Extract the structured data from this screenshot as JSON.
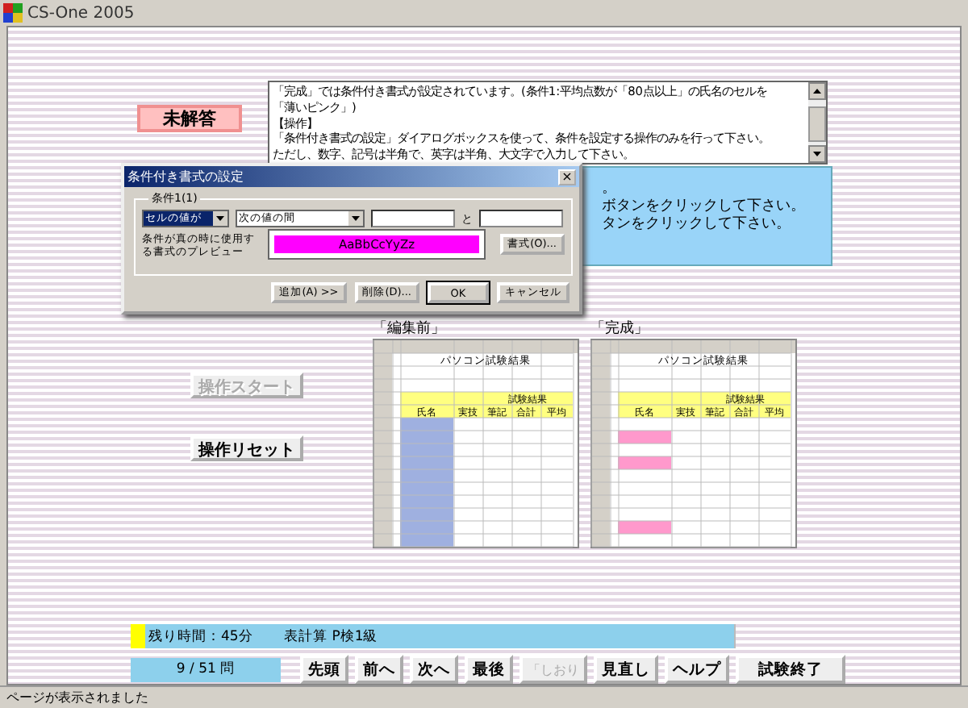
{
  "window": {
    "title": "CS-One 2005"
  },
  "answer_badge": "未解答",
  "instructions": [
    "「完成」では条件付き書式が設定されています。(条件1:平均点数が「80点以上」の氏名のセルを",
    "「薄いピンク」)",
    "【操作】",
    "「条件付き書式の設定」ダイアログボックスを使って、条件を設定する操作のみを行って下さい。",
    "ただし、数字、記号は半角で、英字は半角、大文字で入力して下さい。"
  ],
  "hint_panel": [
    "。",
    "ボタンをクリックして下さい。",
    "タンをクリックして下さい。"
  ],
  "dialog": {
    "title": "条件付き書式の設定",
    "close": "×",
    "group": "条件1(1)",
    "condition_type": "セルの値が",
    "operator": "次の値の間",
    "and_label": "と",
    "preview_label": "条件が真の時に使用する書式のプレビュー",
    "preview_text": "AaBbCcYyZz",
    "format_button": "書式(O)...",
    "buttons": [
      "追加(A) >>",
      "削除(D)...",
      "OK",
      "キャンセル"
    ]
  },
  "sheets": [
    {
      "caption": "「編集前」",
      "title": "パソコン試験結果",
      "group_header": "試験結果",
      "columns": [
        "氏名",
        "実技",
        "筆記",
        "合計",
        "平均"
      ],
      "name_selection": true,
      "rows": [
        {
          "highlighted": false
        },
        {
          "highlighted": false
        },
        {
          "highlighted": false
        },
        {
          "highlighted": false
        },
        {
          "highlighted": false
        },
        {
          "highlighted": false
        },
        {
          "highlighted": false
        },
        {
          "highlighted": false
        },
        {
          "highlighted": false
        },
        {
          "highlighted": false
        }
      ]
    },
    {
      "caption": "「完成」",
      "title": "パソコン試験結果",
      "group_header": "試験結果",
      "columns": [
        "氏名",
        "実技",
        "筆記",
        "合計",
        "平均"
      ],
      "name_selection": false,
      "rows": [
        {
          "highlighted": false
        },
        {
          "highlighted": true
        },
        {
          "highlighted": false
        },
        {
          "highlighted": true
        },
        {
          "highlighted": false
        },
        {
          "highlighted": false
        },
        {
          "highlighted": false
        },
        {
          "highlighted": false
        },
        {
          "highlighted": true
        },
        {
          "highlighted": false
        }
      ]
    }
  ],
  "operation_buttons": [
    {
      "label": "操作スタート",
      "disabled": true
    },
    {
      "label": "操作リセット",
      "disabled": false
    }
  ],
  "remaining_time": "残り時間：45分",
  "subject": "表計算 P検1級",
  "progress": "9 / 51 問",
  "nav_buttons": [
    {
      "label": "先頭",
      "disabled": false
    },
    {
      "label": "前へ",
      "disabled": false
    },
    {
      "label": "次へ",
      "disabled": false
    },
    {
      "label": "最後",
      "disabled": false
    },
    {
      "label": "「しおり",
      "disabled": true
    },
    {
      "label": "見直し",
      "disabled": false
    },
    {
      "label": "ヘルプ",
      "disabled": false
    },
    {
      "label": "試験終了",
      "disabled": false
    }
  ],
  "status_bar": "ページが表示されました"
}
